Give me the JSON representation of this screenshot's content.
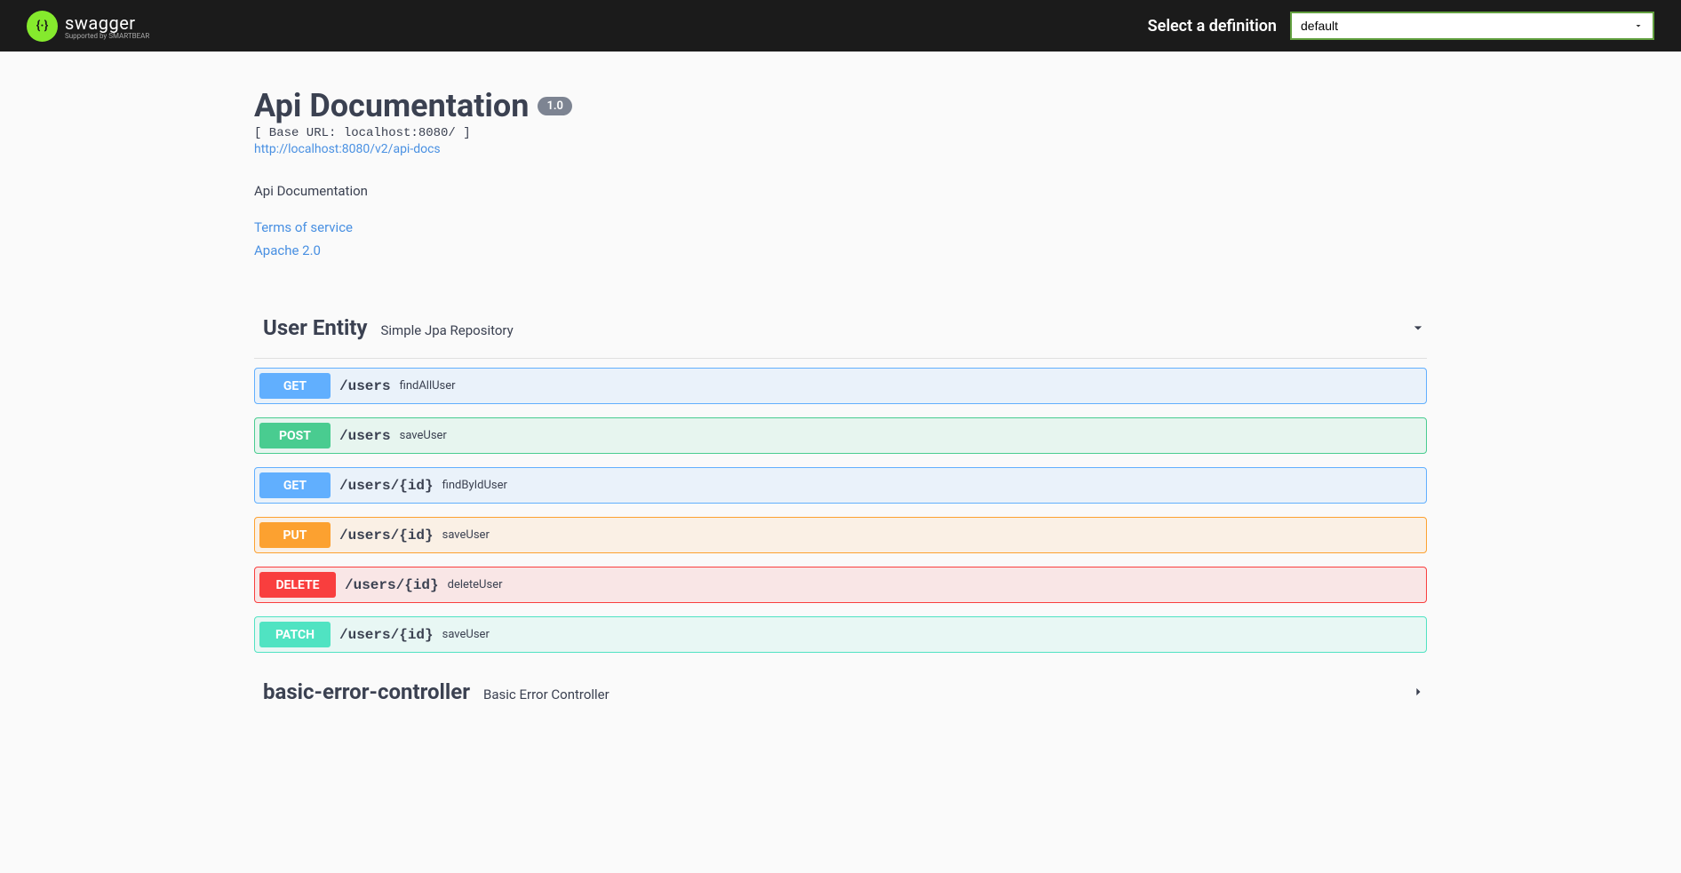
{
  "topbar": {
    "logo_title": "swagger",
    "logo_sub": "Supported by SMARTBEAR",
    "select_label": "Select a definition",
    "select_value": "default"
  },
  "info": {
    "title": "Api Documentation",
    "version": "1.0",
    "base_url": "[ Base URL: localhost:8080/ ]",
    "docs_url": "http://localhost:8080/v2/api-docs",
    "description": "Api Documentation",
    "terms_link": "Terms of service",
    "license_link": "Apache 2.0"
  },
  "tags": [
    {
      "name": "User Entity",
      "desc": "Simple Jpa Repository",
      "expanded": true,
      "ops": [
        {
          "method": "GET",
          "path": "/users",
          "summary": "findAllUser",
          "cls": "op-get"
        },
        {
          "method": "POST",
          "path": "/users",
          "summary": "saveUser",
          "cls": "op-post"
        },
        {
          "method": "GET",
          "path": "/users/{id}",
          "summary": "findByIdUser",
          "cls": "op-get"
        },
        {
          "method": "PUT",
          "path": "/users/{id}",
          "summary": "saveUser",
          "cls": "op-put"
        },
        {
          "method": "DELETE",
          "path": "/users/{id}",
          "summary": "deleteUser",
          "cls": "op-delete"
        },
        {
          "method": "PATCH",
          "path": "/users/{id}",
          "summary": "saveUser",
          "cls": "op-patch"
        }
      ]
    },
    {
      "name": "basic-error-controller",
      "desc": "Basic Error Controller",
      "expanded": false,
      "ops": []
    }
  ]
}
